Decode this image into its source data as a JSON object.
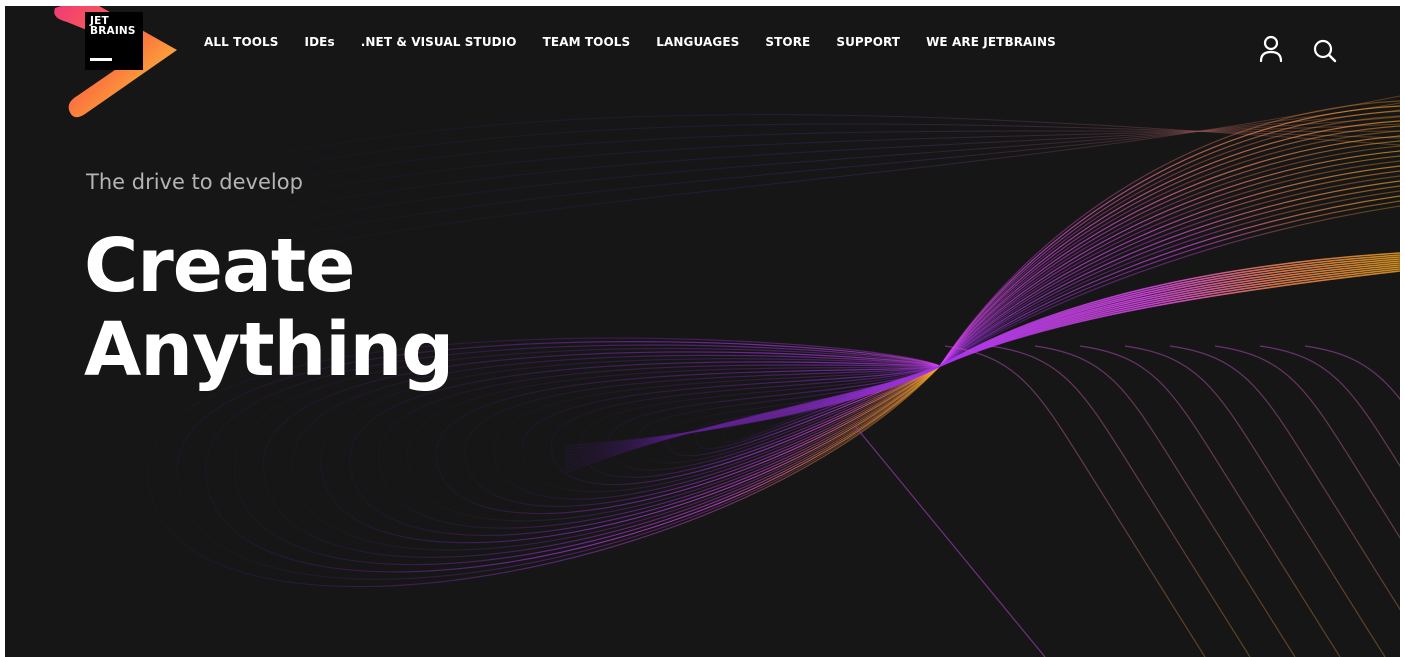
{
  "brand": {
    "logo_line1": "JET",
    "logo_line2": "BRAINS"
  },
  "nav": {
    "items": [
      {
        "label": "ALL TOOLS"
      },
      {
        "label": "IDEs"
      },
      {
        "label": ".NET & VISUAL STUDIO"
      },
      {
        "label": "TEAM TOOLS"
      },
      {
        "label": "LANGUAGES"
      },
      {
        "label": "STORE"
      },
      {
        "label": "SUPPORT"
      },
      {
        "label": "WE ARE JETBRAINS"
      }
    ]
  },
  "header_icons": {
    "account": "user-icon",
    "search": "search-icon"
  },
  "hero": {
    "tagline": "The drive to develop",
    "headline_line1": "Create",
    "headline_line2": "Anything"
  },
  "colors": {
    "background": "#161616",
    "wave_magenta": "#e040fb",
    "wave_purple": "#7a2ad0",
    "wave_orange": "#f5a623",
    "logo_pink": "#f0357a",
    "logo_yellow": "#f8e03a"
  }
}
